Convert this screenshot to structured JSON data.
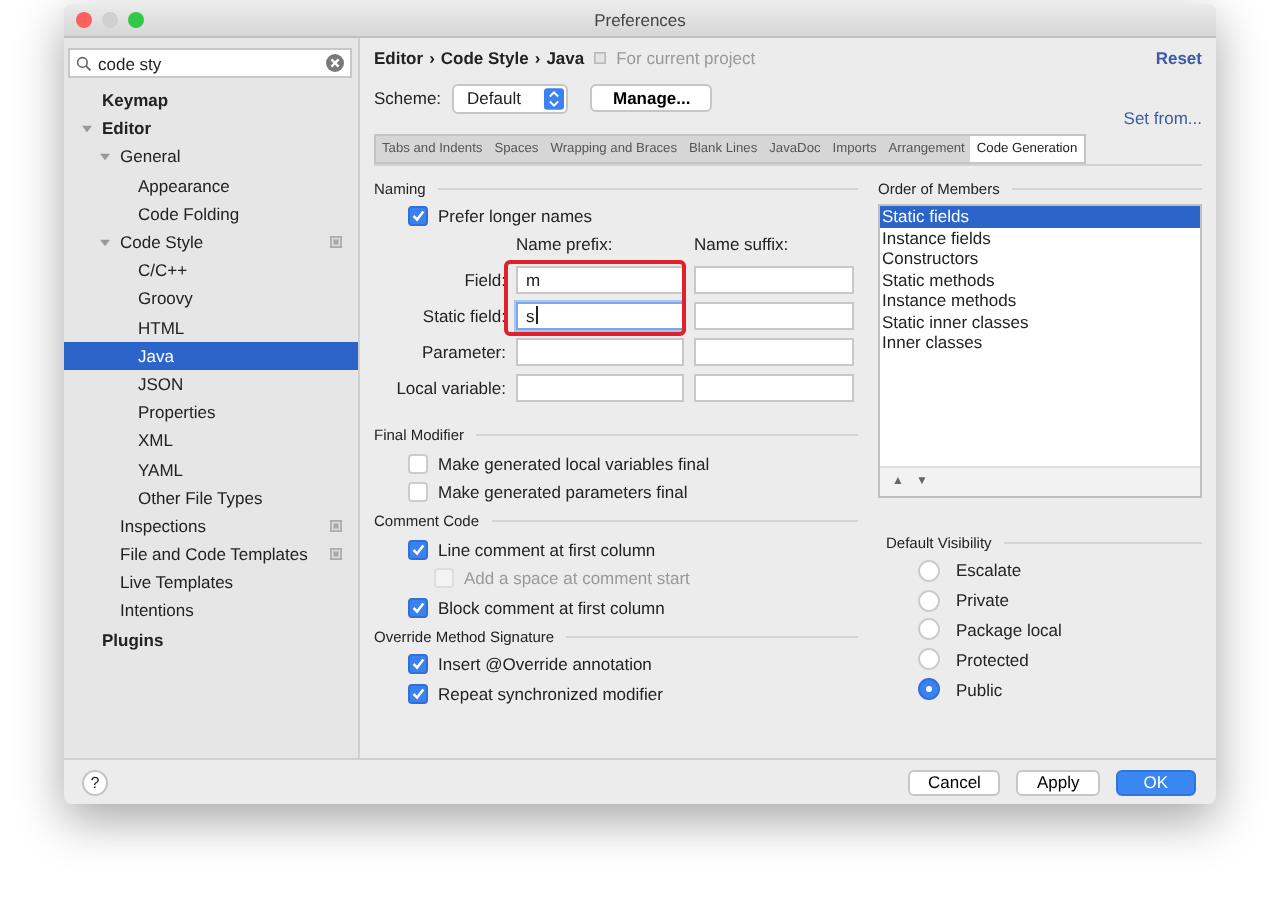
{
  "window": {
    "title": "Preferences"
  },
  "search": {
    "value": "code sty"
  },
  "sidebar": {
    "items": [
      {
        "label": "Keymap",
        "selected": false
      },
      {
        "label": "Editor",
        "selected": false,
        "expanded": true,
        "children": [
          {
            "label": "General",
            "selected": false,
            "expanded": true,
            "children": [
              {
                "label": "Appearance",
                "selected": false
              },
              {
                "label": "Code Folding",
                "selected": false
              }
            ]
          },
          {
            "label": "Code Style",
            "selected": false,
            "expanded": true,
            "project_scope": true,
            "children": [
              {
                "label": "C/C++",
                "selected": false
              },
              {
                "label": "Groovy",
                "selected": false
              },
              {
                "label": "HTML",
                "selected": false
              },
              {
                "label": "Java",
                "selected": true
              },
              {
                "label": "JSON",
                "selected": false
              },
              {
                "label": "Properties",
                "selected": false
              },
              {
                "label": "XML",
                "selected": false
              },
              {
                "label": "YAML",
                "selected": false
              },
              {
                "label": "Other File Types",
                "selected": false
              }
            ]
          },
          {
            "label": "Inspections",
            "selected": false,
            "project_scope": true
          },
          {
            "label": "File and Code Templates",
            "selected": false,
            "project_scope": true
          },
          {
            "label": "Live Templates",
            "selected": false
          },
          {
            "label": "Intentions",
            "selected": false
          }
        ]
      },
      {
        "label": "Plugins",
        "selected": false
      }
    ]
  },
  "breadcrumb": {
    "parts": [
      "Editor",
      "Code Style",
      "Java"
    ],
    "separator": "›",
    "scope": "For current project",
    "reset": "Reset"
  },
  "scheme": {
    "label": "Scheme:",
    "value": "Default",
    "manage": "Manage...",
    "set_from": "Set from..."
  },
  "tabs": [
    {
      "label": "Tabs and Indents",
      "selected": false
    },
    {
      "label": "Spaces",
      "selected": false
    },
    {
      "label": "Wrapping and Braces",
      "selected": false
    },
    {
      "label": "Blank Lines",
      "selected": false
    },
    {
      "label": "JavaDoc",
      "selected": false
    },
    {
      "label": "Imports",
      "selected": false
    },
    {
      "label": "Arrangement",
      "selected": false
    },
    {
      "label": "Code Generation",
      "selected": true
    }
  ],
  "naming": {
    "title": "Naming",
    "prefer_longer": {
      "label": "Prefer longer names",
      "checked": true
    },
    "columns": [
      "Name prefix:",
      "Name suffix:"
    ],
    "rows": [
      {
        "label": "Field:",
        "prefix": "m",
        "focused": false
      },
      {
        "label": "Static field:",
        "prefix": "s",
        "focused": true
      },
      {
        "label": "Parameter:",
        "focused": false
      },
      {
        "label": "Local variable:",
        "focused": false
      }
    ]
  },
  "option_groups": [
    {
      "title": "Final Modifier",
      "options": [
        {
          "label": "Make generated local variables final",
          "checked": false,
          "disabled": false
        },
        {
          "label": "Make generated parameters final",
          "checked": false,
          "disabled": false
        }
      ]
    },
    {
      "title": "Comment Code",
      "options": [
        {
          "label": "Line comment at first column",
          "checked": true,
          "disabled": false,
          "children": [
            {
              "label": "Add a space at comment start",
              "checked": false,
              "disabled": true
            }
          ]
        },
        {
          "label": "Block comment at first column",
          "checked": true,
          "disabled": false
        }
      ]
    },
    {
      "title": "Override Method Signature",
      "options": [
        {
          "label": "Insert @Override annotation",
          "checked": true,
          "disabled": false
        },
        {
          "label": "Repeat synchronized modifier",
          "checked": true,
          "disabled": false
        }
      ]
    }
  ],
  "order_of_members": {
    "title": "Order of Members",
    "items": [
      {
        "label": "Static fields",
        "selected": true
      },
      {
        "label": "Instance fields",
        "selected": false
      },
      {
        "label": "Constructors",
        "selected": false
      },
      {
        "label": "Static methods",
        "selected": false
      },
      {
        "label": "Instance methods",
        "selected": false
      },
      {
        "label": "Static inner classes",
        "selected": false
      },
      {
        "label": "Inner classes",
        "selected": false
      }
    ],
    "move_up": "▲",
    "move_down": "▼"
  },
  "default_visibility": {
    "title": "Default Visibility",
    "options": [
      {
        "label": "Escalate",
        "selected": false
      },
      {
        "label": "Private",
        "selected": false
      },
      {
        "label": "Package local",
        "selected": false
      },
      {
        "label": "Protected",
        "selected": false
      },
      {
        "label": "Public",
        "selected": true
      }
    ]
  },
  "footer": {
    "help": "?",
    "buttons": [
      {
        "label": "Cancel",
        "default": false
      },
      {
        "label": "Apply",
        "default": false
      },
      {
        "label": "OK",
        "default": true
      }
    ]
  }
}
